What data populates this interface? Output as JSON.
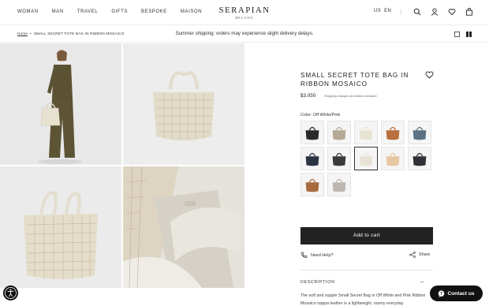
{
  "header": {
    "nav": [
      "WOMAN",
      "MAN",
      "TRAVEL",
      "GIFTS",
      "BESPOKE",
      "MAISON"
    ],
    "brand": "SERAPIAN",
    "brand_sub": "MILANO",
    "locale": "US",
    "language": "EN"
  },
  "breadcrumb": {
    "home": "Home",
    "current": "SMALL SECRET TOTE BAG IN RIBBON MOSAICO"
  },
  "promo": "Summer shipping: orders may experience slight delivery delays.",
  "product": {
    "title": "SMALL SECRET TOTE BAG IN RIBBON MOSAICO",
    "price": "$3.050",
    "ship_note": "Shipping charges and duties included",
    "color_label": "Color: Off White/Pink",
    "swatches": [
      {
        "color": "#2a2a2c"
      },
      {
        "color": "#b5a894"
      },
      {
        "color": "#e7e3d3"
      },
      {
        "color": "#b8703f"
      },
      {
        "color": "#5d7284"
      },
      {
        "color": "#2b3344"
      },
      {
        "color": "#3a3a3a"
      },
      {
        "color": "#e8e3d6"
      },
      {
        "color": "#e6c7a2"
      },
      {
        "color": "#2f3136"
      },
      {
        "color": "#a86a3c"
      },
      {
        "color": "#bdb7b2"
      }
    ],
    "selected_index": 7,
    "add_to_cart": "Add to cart",
    "need_help": "Need Help?",
    "share": "Share",
    "description_head": "DESCRIPTION",
    "description_toggle": "–",
    "description_text": "The soft and supple Small Secret Bag in Off White and Pink Ribbon Mosaico nappa leather is a lightweight, roomy everyday"
  },
  "contact_label": "Contact us"
}
